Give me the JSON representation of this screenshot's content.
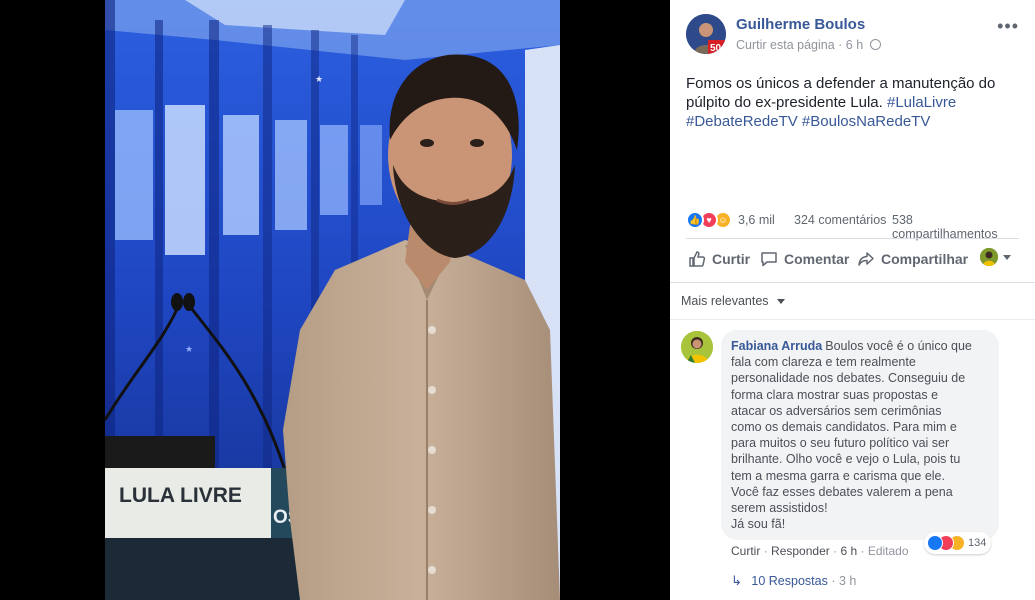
{
  "photo": {
    "sign_text": "LULA LIVRE",
    "sign_partial_text": "OS"
  },
  "post": {
    "author": "Guilherme Boulos",
    "avatar_badge": "50",
    "like_page": "Curtir esta página",
    "time": "6 h",
    "text_plain": "Fomos os únicos a defender a manutenção do púlpito do ex-presidente Lula.",
    "hashtags": [
      "#LulaLivre",
      "#DebateRedeTV",
      "#BoulosNaRedeTV"
    ],
    "reactions_count": "3,6 mil",
    "comments_count": "324 comentários",
    "shares_count": "538 compartilhamentos",
    "reaction_types": [
      "like-icon",
      "love-icon",
      "haha-icon"
    ]
  },
  "actions": {
    "like": "Curtir",
    "comment": "Comentar",
    "share": "Compartilhar"
  },
  "comments_sort": {
    "label": "Mais relevantes"
  },
  "comment": {
    "author": "Fabiana Arruda",
    "body_lines": [
      "Boulos você é o único que",
      "fala com clareza e tem realmente",
      "personalidade nos debates. Conseguiu de",
      "forma clara mostrar suas propostas e",
      "atacar os adversários sem cerimônias",
      "como os demais candidatos. Para mim e",
      "para muitos o seu futuro político vai ser",
      "brilhante. Olho você e vejo o Lula, pois tu",
      "tem a mesma garra e carisma que ele.",
      "Você faz esses debates valerem a pena",
      "serem assistidos!",
      "Já sou fã!"
    ],
    "reactions_count": "134",
    "like": "Curtir",
    "reply": "Responder",
    "time": "6 h",
    "edited": "Editado",
    "replies_label": "10 Respostas",
    "replies_time": "3 h"
  },
  "colors": {
    "link": "#385898",
    "muted": "#90949c",
    "like_blue": "#1877f2",
    "love_red": "#f33e58",
    "haha_yellow": "#f7b125"
  }
}
